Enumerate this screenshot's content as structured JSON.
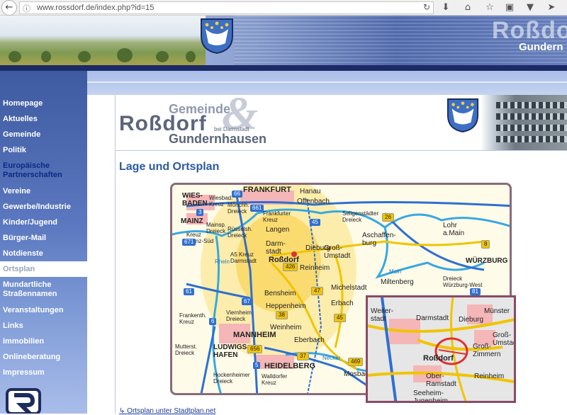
{
  "browser": {
    "url": "www.rossdorf.de/index.php?id=15"
  },
  "banner": {
    "name": "Roßdorf",
    "sub": "Gundern"
  },
  "sidebar": {
    "items": [
      {
        "label": "Homepage"
      },
      {
        "label": "Aktuelles"
      },
      {
        "label": "Gemeinde"
      },
      {
        "label": "Politik"
      },
      {
        "label": "Europäische\nPartnerschaften"
      },
      {
        "label": "Vereine"
      },
      {
        "label": "Gewerbe/Industrie"
      },
      {
        "label": "Kinder/Jugend"
      },
      {
        "label": "Bürger-Mail"
      },
      {
        "label": "Notdienste"
      },
      {
        "label": "Ortsplan"
      },
      {
        "label": "Mundartliche\nStraßennamen"
      },
      {
        "label": "Veranstaltungen"
      },
      {
        "label": "Links"
      },
      {
        "label": "Immobilien"
      },
      {
        "label": "Onlineberatung"
      },
      {
        "label": "Impressum"
      }
    ]
  },
  "logo": {
    "gemeinde": "Gemeinde",
    "rossdorf": "Roßdorf",
    "amp": "&",
    "bei": "bei Darmstadt",
    "gundernhausen": "Gundernhausen"
  },
  "page": {
    "heading": "Lage und Ortsplan"
  },
  "map": {
    "labels": {
      "frankfurt": "FRANKFURT",
      "hanau": "Hanau",
      "offenbach": "Offenbach",
      "wiesbaden": "WIES-\nBADEN",
      "wiesbadKreuz": "Wiesbad.\nKreuz",
      "moenchhof": "Mönchh.\nDreieck",
      "frankfurterKreuz": "Frankfurter\nKreuz",
      "seligenstaedter": "Seligenstädter\nDreieck",
      "mainz": "MAINZ",
      "mainspitz": "Mainsp.\nDreieck",
      "ruesselsheim": "Rüsselsh.\nDreieck",
      "langen": "Langen",
      "kreuzMainzSued": "Kreuz\nMainz-Süd",
      "aschaffenburg": "Aschaffen-\nburg",
      "lohr": "Lohr\na.Main",
      "darmstadt": "Darm-\nstadt",
      "rossdorf": "Roßdorf",
      "dieburg": "Dieburg",
      "grossUmstadt": "Groß-\nUmstadt",
      "a5Kreuz": "A5 Kreuz\nDarmstadt",
      "reinheim": "Reinheim",
      "rhein": "Rhein",
      "main": "Main",
      "wuerzburg": "WÜRZBURG",
      "miltenberg": "Miltenberg",
      "dreieckWuerzburg": "Dreieck\nWürzburg-West",
      "bensheim": "Bensheim",
      "michelstadt": "Michelstadt",
      "heppenheim": "Heppenheim",
      "erbach": "Erbach",
      "frankenthal": "Frankenth.\nKreuz",
      "viernheim": "Viernheim\nDreieck",
      "weinheim": "Weinheim",
      "mannheim": "MANNHEIM",
      "eberbach": "Eberbach",
      "mutterstadt": "Mutterst.\nDreieck",
      "ludwigshafen": "LUDWIGS-\nHAFEN",
      "neckar": "Neckar",
      "heidelberg": "HEIDELBERG",
      "mosbach": "Mosbach",
      "hockenheim": "Hockenheimer\nDreieck",
      "walldorf": "Walldorfer\nKreuz",
      "insetWeiterstadt": "Weiter-\nstadt",
      "insetDarmstadt": "Darmstadt",
      "insetDieburg": "Dieburg",
      "insetMuenster": "Münster",
      "insetGrossZimmern": "Groß-\nZimmern",
      "insetGrossUmstadt": "Groß-\nUmstadt",
      "insetRossdorf": "Roßdorf",
      "insetOberRamstadt": "Ober-\nRamstadt",
      "insetReinheim": "Reinheim",
      "insetSeeheim": "Seeheim-\nJugenheim"
    },
    "roads": {
      "a3": "3",
      "a66": "66",
      "a661": "661",
      "a45": "45",
      "a671": "671",
      "a67": "67",
      "a5": "5",
      "a6": "6",
      "a61": "61",
      "a81": "81",
      "b26": "26",
      "b426": "426",
      "b45": "45",
      "b47": "47",
      "b38": "38",
      "b37": "37",
      "b469": "469",
      "b8": "8",
      "b656": "656"
    }
  },
  "footer": {
    "link": "Ortsplan unter Stadtplan.net"
  }
}
